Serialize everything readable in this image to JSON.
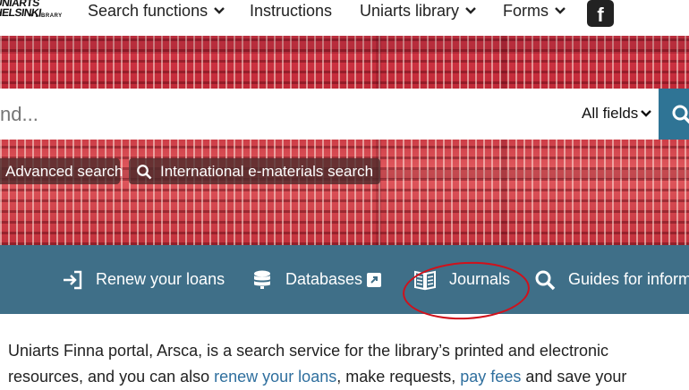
{
  "logo": {
    "line1": "UNIARTS",
    "line2": "HELSINKI",
    "line3": "✕ LIBRARY"
  },
  "nav": {
    "search_functions": "Search functions",
    "instructions": "Instructions",
    "library": "Uniarts library",
    "forms": "Forms"
  },
  "search": {
    "placeholder": "nd...",
    "scope": "All fields"
  },
  "pills": {
    "advanced": "Advanced search",
    "international": "International e-materials search"
  },
  "quick_links": {
    "renew": "Renew your loans",
    "databases": "Databases",
    "journals": "Journals",
    "guides": "Guides for inform"
  },
  "intro": {
    "text1": "Uniarts Finna portal, Arsca, is a search service for the library’s printed and electronic resources, and you can also ",
    "link_renew": "renew your loans",
    "text2": ", make requests, ",
    "link_fees": "pay fees",
    "text3": " and save your"
  },
  "colors": {
    "band": "#3f6f88",
    "accent": "#2f7495",
    "annotation": "#d0111b"
  },
  "icons": [
    "chevron-down-icon",
    "facebook-icon",
    "search-icon",
    "login-icon",
    "database-icon",
    "external-link-icon",
    "book-icon"
  ]
}
